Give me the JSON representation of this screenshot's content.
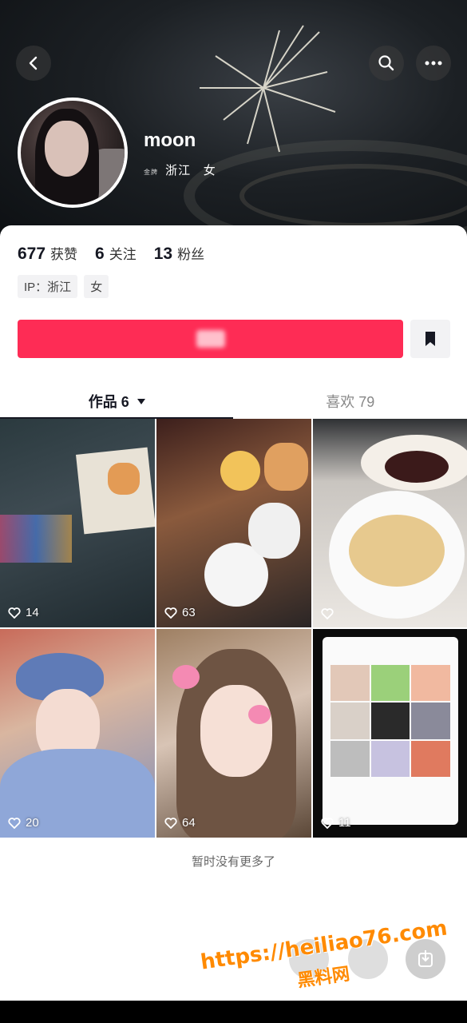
{
  "header": {
    "back_icon": "back-arrow-icon",
    "search_icon": "search-icon",
    "more_icon": "more-dots-icon"
  },
  "profile": {
    "username": "moon",
    "location_prefix": "金牌",
    "location": "浙江",
    "gender": "女"
  },
  "stats": {
    "likes_count": "677",
    "likes_label": "获赞",
    "following_count": "6",
    "following_label": "关注",
    "followers_count": "13",
    "followers_label": "粉丝"
  },
  "tags": [
    "IP：浙江",
    "女"
  ],
  "colors": {
    "accent": "#fe2c55",
    "text": "#161823",
    "muted": "#888888"
  },
  "tabs": {
    "works": "作品 6",
    "likes": "喜欢 79"
  },
  "videos": [
    {
      "likes": "14"
    },
    {
      "likes": "63"
    },
    {
      "likes": ""
    },
    {
      "likes": "20"
    },
    {
      "likes": "64"
    },
    {
      "likes": "11"
    }
  ],
  "end_text": "暂时没有更多了",
  "watermark": {
    "url": "https://heiliao76.com",
    "name": "黑料网"
  }
}
